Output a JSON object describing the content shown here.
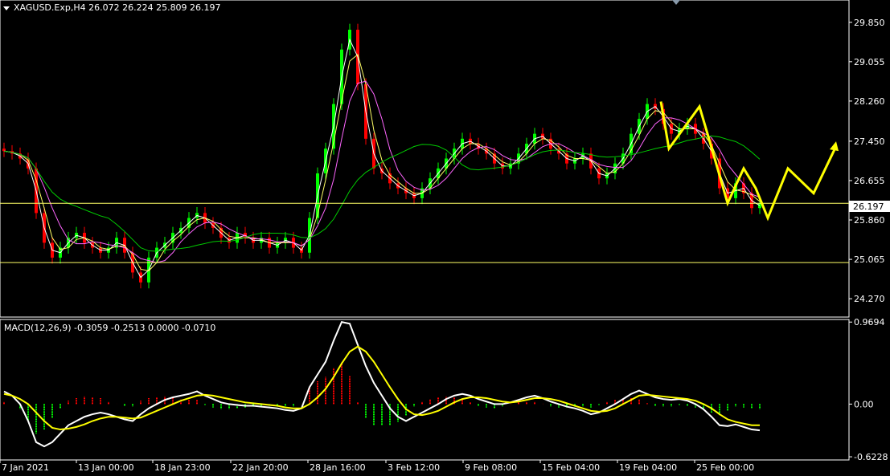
{
  "header": {
    "symbol_line": "XAGUSD.Exp,H4  26.072 26.224 25.809 26.197",
    "menu_icon": "triangle-down-icon"
  },
  "macd_header": "MACD(12,26,9) -0.3059 -0.2513 0.0000 -0.0710",
  "current_price_label": "26.197",
  "colors": {
    "background": "#000000",
    "bull_candle": "#00ff00",
    "bear_candle": "#ff0000",
    "price_line": "#ffffff",
    "support_line": "#ffff66",
    "ma_fast": "#ffffff",
    "ma_mid": "#ffff66",
    "ma_slow": "#ff66ff",
    "ma_long": "#00cc00",
    "forecast": "#ffff00",
    "macd_line": "#ffffff",
    "signal_line": "#ffff00"
  },
  "chart_data": [
    {
      "type": "line",
      "title": "XAGUSD.Exp,H4  26.072 26.224 25.809 26.197",
      "ylim": [
        23.9,
        30.3
      ],
      "y_ticks": [
        "29.850",
        "29.055",
        "28.260",
        "27.450",
        "26.655",
        "25.860",
        "25.065",
        "24.270"
      ],
      "horizontal_lines": [
        26.197,
        25.0
      ],
      "series": [
        {
          "kind": "close",
          "x": [
            0,
            10,
            20,
            30,
            40,
            50,
            60,
            70,
            80,
            90,
            100,
            110,
            120,
            130,
            140,
            150,
            160,
            170,
            180,
            190,
            200,
            210,
            220,
            230,
            240,
            250,
            260,
            270,
            280,
            290,
            300,
            310,
            320,
            330,
            340,
            350,
            360,
            370,
            380,
            390,
            400,
            410,
            420,
            430,
            440,
            450,
            460,
            470,
            480,
            490,
            500,
            510,
            520,
            530,
            540,
            550,
            560,
            570,
            580,
            590,
            600,
            610,
            620,
            630,
            640,
            650,
            660,
            670,
            680,
            690,
            700,
            710,
            720,
            730,
            740,
            750,
            760,
            770,
            780,
            790,
            800,
            810,
            820,
            830,
            840,
            850,
            860,
            870,
            880,
            890,
            900,
            910,
            920,
            930,
            940
          ],
          "values": [
            27.25,
            27.2,
            27.1,
            26.9,
            26.0,
            25.4,
            25.1,
            25.3,
            25.5,
            25.6,
            25.4,
            25.3,
            25.2,
            25.3,
            25.5,
            25.2,
            24.8,
            24.6,
            25.1,
            25.3,
            25.4,
            25.6,
            25.7,
            25.9,
            26.0,
            25.8,
            25.7,
            25.5,
            25.4,
            25.6,
            25.5,
            25.4,
            25.5,
            25.3,
            25.4,
            25.5,
            25.3,
            25.2,
            25.9,
            26.8,
            27.3,
            28.2,
            29.3,
            29.7,
            28.6,
            27.5,
            26.9,
            26.8,
            26.6,
            26.5,
            26.4,
            26.3,
            26.5,
            26.7,
            26.9,
            27.1,
            27.3,
            27.5,
            27.4,
            27.3,
            27.2,
            27.0,
            26.9,
            27.0,
            27.2,
            27.4,
            27.6,
            27.5,
            27.3,
            27.2,
            27.0,
            27.1,
            27.2,
            26.9,
            26.7,
            26.8,
            27.0,
            27.2,
            27.6,
            27.9,
            28.2,
            28.1,
            27.8,
            27.6,
            27.7,
            27.8,
            27.6,
            27.4,
            27.1,
            26.5,
            26.3,
            26.6,
            26.4,
            26.1,
            26.2
          ]
        }
      ]
    },
    {
      "type": "line",
      "title": "MACD(12,26,9) -0.3059 -0.2513 0.0000 -0.0710",
      "ylim": [
        -0.66,
        1.0
      ],
      "y_ticks": [
        "0.9694",
        "0.00",
        "-0.6228"
      ],
      "x_tick_labels": [
        "7 Jan 2021",
        "13 Jan 00:00",
        "18 Jan 23:00",
        "22 Jan 20:00",
        "28 Jan 16:00",
        "3 Feb 12:00",
        "9 Feb 08:00",
        "15 Feb 04:00",
        "19 Feb 04:00",
        "25 Feb 00:00"
      ],
      "series": [
        {
          "kind": "macd",
          "x": [
            0,
            10,
            20,
            30,
            40,
            50,
            60,
            70,
            80,
            90,
            100,
            110,
            120,
            130,
            140,
            150,
            160,
            170,
            180,
            190,
            200,
            210,
            220,
            230,
            240,
            250,
            260,
            270,
            280,
            290,
            300,
            310,
            320,
            330,
            340,
            350,
            360,
            370,
            380,
            390,
            400,
            410,
            420,
            430,
            440,
            450,
            460,
            470,
            480,
            490,
            500,
            510,
            520,
            530,
            540,
            550,
            560,
            570,
            580,
            590,
            600,
            610,
            620,
            630,
            640,
            650,
            660,
            670,
            680,
            690,
            700,
            710,
            720,
            730,
            740,
            750,
            760,
            770,
            780,
            790,
            800,
            810,
            820,
            830,
            840,
            850,
            860,
            870,
            880,
            890,
            900,
            910,
            920,
            930,
            940
          ],
          "values": [
            0.15,
            0.1,
            0.0,
            -0.2,
            -0.45,
            -0.5,
            -0.45,
            -0.35,
            -0.25,
            -0.2,
            -0.15,
            -0.12,
            -0.1,
            -0.12,
            -0.15,
            -0.18,
            -0.2,
            -0.12,
            -0.05,
            0.0,
            0.05,
            0.08,
            0.1,
            0.12,
            0.15,
            0.1,
            0.06,
            0.02,
            0.0,
            -0.01,
            -0.02,
            -0.02,
            -0.03,
            -0.04,
            -0.05,
            -0.07,
            -0.08,
            -0.05,
            0.2,
            0.35,
            0.5,
            0.75,
            0.97,
            0.95,
            0.7,
            0.45,
            0.25,
            0.1,
            -0.05,
            -0.15,
            -0.2,
            -0.15,
            -0.1,
            -0.05,
            0.0,
            0.06,
            0.1,
            0.12,
            0.1,
            0.06,
            0.03,
            0.0,
            0.0,
            0.02,
            0.05,
            0.08,
            0.1,
            0.07,
            0.03,
            0.0,
            -0.03,
            -0.05,
            -0.08,
            -0.12,
            -0.1,
            -0.05,
            0.0,
            0.06,
            0.12,
            0.16,
            0.12,
            0.08,
            0.06,
            0.05,
            0.06,
            0.04,
            0.0,
            -0.06,
            -0.15,
            -0.25,
            -0.26,
            -0.24,
            -0.27,
            -0.3,
            -0.31
          ]
        },
        {
          "kind": "signal",
          "x": [
            0,
            10,
            20,
            30,
            40,
            50,
            60,
            70,
            80,
            90,
            100,
            110,
            120,
            130,
            140,
            150,
            160,
            170,
            180,
            190,
            200,
            210,
            220,
            230,
            240,
            250,
            260,
            270,
            280,
            290,
            300,
            310,
            320,
            330,
            340,
            350,
            360,
            370,
            380,
            390,
            400,
            410,
            420,
            430,
            440,
            450,
            460,
            470,
            480,
            490,
            500,
            510,
            520,
            530,
            540,
            550,
            560,
            570,
            580,
            590,
            600,
            610,
            620,
            630,
            640,
            650,
            660,
            670,
            680,
            690,
            700,
            710,
            720,
            730,
            740,
            750,
            760,
            770,
            780,
            790,
            800,
            810,
            820,
            830,
            840,
            850,
            860,
            870,
            880,
            890,
            900,
            910,
            920,
            930,
            940
          ],
          "values": [
            0.12,
            0.1,
            0.06,
            0.0,
            -0.1,
            -0.2,
            -0.28,
            -0.3,
            -0.29,
            -0.27,
            -0.24,
            -0.2,
            -0.17,
            -0.15,
            -0.15,
            -0.16,
            -0.17,
            -0.16,
            -0.12,
            -0.08,
            -0.04,
            0.0,
            0.04,
            0.07,
            0.1,
            0.11,
            0.1,
            0.08,
            0.06,
            0.04,
            0.02,
            0.01,
            0.0,
            -0.01,
            -0.02,
            -0.04,
            -0.05,
            -0.05,
            0.0,
            0.08,
            0.18,
            0.32,
            0.48,
            0.62,
            0.68,
            0.62,
            0.5,
            0.35,
            0.2,
            0.06,
            -0.06,
            -0.12,
            -0.13,
            -0.11,
            -0.08,
            -0.03,
            0.02,
            0.06,
            0.08,
            0.08,
            0.07,
            0.05,
            0.03,
            0.02,
            0.03,
            0.05,
            0.07,
            0.07,
            0.06,
            0.04,
            0.01,
            -0.02,
            -0.05,
            -0.08,
            -0.09,
            -0.08,
            -0.05,
            0.0,
            0.05,
            0.1,
            0.11,
            0.1,
            0.09,
            0.08,
            0.07,
            0.06,
            0.04,
            0.0,
            -0.05,
            -0.12,
            -0.18,
            -0.21,
            -0.23,
            -0.25,
            -0.25
          ]
        }
      ]
    }
  ]
}
